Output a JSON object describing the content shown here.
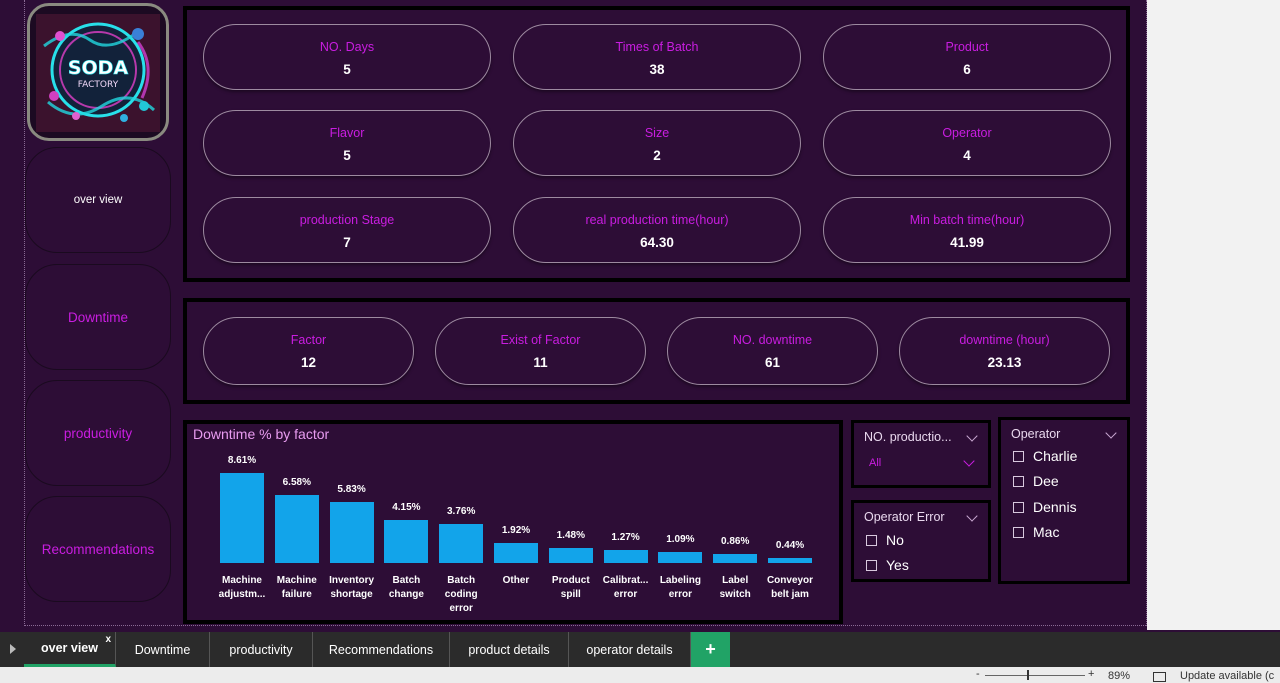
{
  "nav": {
    "items": [
      {
        "label": "over view",
        "color": "#ffffff"
      },
      {
        "label": "Downtime",
        "color": "#c91de0"
      },
      {
        "label": "productivity",
        "color": "#c91de0"
      },
      {
        "label": "Recommendations",
        "color": "#c91de0"
      }
    ]
  },
  "logo": {
    "line1": "SODA",
    "line2": "FACTORY"
  },
  "kpis_top": [
    {
      "label": "NO. Days",
      "value": "5"
    },
    {
      "label": "Times of Batch",
      "value": "38"
    },
    {
      "label": "Product",
      "value": "6"
    },
    {
      "label": "Flavor",
      "value": "5"
    },
    {
      "label": "Size",
      "value": "2"
    },
    {
      "label": "Operator",
      "value": "4"
    },
    {
      "label": "production Stage",
      "value": "7"
    },
    {
      "label": "real production time(hour)",
      "value": "64.30"
    },
    {
      "label": "Min batch time(hour)",
      "value": "41.99"
    }
  ],
  "kpis_downtime": [
    {
      "label": "Factor",
      "value": "12"
    },
    {
      "label": "Exist of Factor",
      "value": "11"
    },
    {
      "label": "NO. downtime",
      "value": "61"
    },
    {
      "label": "downtime (hour)",
      "value": "23.13"
    }
  ],
  "chart_data": {
    "type": "bar",
    "title": "Downtime % by factor",
    "xlabel": "",
    "ylabel": "",
    "categories": [
      "Machine adjustm...",
      "Machine failure",
      "Inventory shortage",
      "Batch change",
      "Batch coding error",
      "Other",
      "Product spill",
      "Calibrat... error",
      "Labeling error",
      "Label switch",
      "Conveyor belt jam"
    ],
    "category_lines": [
      [
        "Machine",
        "adjustm..."
      ],
      [
        "Machine",
        "failure"
      ],
      [
        "Inventory",
        "shortage"
      ],
      [
        "Batch",
        "change"
      ],
      [
        "Batch",
        "coding",
        "error"
      ],
      [
        "Other"
      ],
      [
        "Product",
        "spill"
      ],
      [
        "Calibrat...",
        "error"
      ],
      [
        "Labeling",
        "error"
      ],
      [
        "Label",
        "switch"
      ],
      [
        "Conveyor",
        "belt jam"
      ]
    ],
    "values": [
      8.61,
      6.58,
      5.83,
      4.15,
      3.76,
      1.92,
      1.48,
      1.27,
      1.09,
      0.86,
      0.44
    ],
    "labels": [
      "8.61%",
      "6.58%",
      "5.83%",
      "4.15%",
      "3.76%",
      "1.92%",
      "1.48%",
      "1.27%",
      "1.09%",
      "0.86%",
      "0.44%"
    ],
    "bar_color": "#12a4ea",
    "grid": false
  },
  "slicers": {
    "production": {
      "title": "NO. productio...",
      "selected": "All"
    },
    "operator_error": {
      "title": "Operator Error",
      "options": [
        "No",
        "Yes"
      ]
    },
    "operator": {
      "title": "Operator",
      "options": [
        "Charlie",
        "Dee",
        "Dennis",
        "Mac"
      ]
    }
  },
  "tabs": {
    "items": [
      "over view",
      "Downtime",
      "productivity",
      "Recommendations",
      "product details",
      "operator details"
    ],
    "active_close": "x",
    "add": "+"
  },
  "status": {
    "zoom_minus": "-",
    "zoom_plus": "+",
    "zoom": "89%",
    "update": "Update available (c"
  },
  "colors": {
    "accent": "#c91de0",
    "background": "#2d0d36",
    "bar": "#12a4ea",
    "add_tab": "#21a366"
  }
}
